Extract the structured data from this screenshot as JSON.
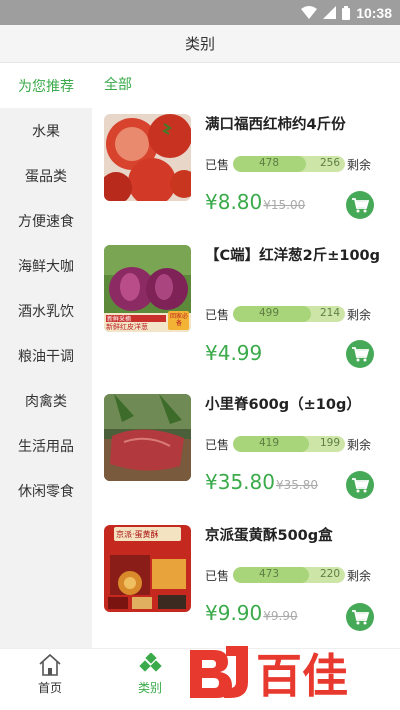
{
  "status_bar": {
    "time": "10:38",
    "icons": [
      "wifi-icon",
      "signal-icon",
      "battery-icon"
    ]
  },
  "header": {
    "title": "类别"
  },
  "sidebar": {
    "items": [
      {
        "label": "为您推荐",
        "active": true
      },
      {
        "label": "水果"
      },
      {
        "label": "蛋品类"
      },
      {
        "label": "方便速食"
      },
      {
        "label": "海鲜大咖"
      },
      {
        "label": "酒水乳饮"
      },
      {
        "label": "粮油干调"
      },
      {
        "label": "肉禽类"
      },
      {
        "label": "生活用品"
      },
      {
        "label": "休闲零食"
      }
    ]
  },
  "main": {
    "filter_label": "全部",
    "products": [
      {
        "name": "满口福西红柿约4斤份",
        "sold_label": "已售",
        "sold": "478",
        "remaining": "256",
        "remaining_label": "剩余",
        "price": "¥8.80",
        "original_price": "¥15.00",
        "sold_fraction": 0.65
      },
      {
        "name": "【C端】红洋葱2斤±100g",
        "sold_label": "已售",
        "sold": "499",
        "remaining": "214",
        "remaining_label": "剩余",
        "price": "¥4.99",
        "original_price": "",
        "sold_fraction": 0.7,
        "image_badges": [
          "新鲜红皮洋葱",
          "新鲜采摘",
          "回家必备"
        ]
      },
      {
        "name": "小里脊600g（±10g）",
        "sold_label": "已售",
        "sold": "419",
        "remaining": "199",
        "remaining_label": "剩余",
        "price": "¥35.80",
        "original_price": "¥35.80",
        "sold_fraction": 0.68
      },
      {
        "name": "京派蛋黄酥500g盒",
        "sold_label": "已售",
        "sold": "473",
        "remaining": "220",
        "remaining_label": "剩余",
        "price": "¥9.90",
        "original_price": "¥9.90",
        "sold_fraction": 0.68,
        "image_badges": [
          "京派·蛋黄酥"
        ]
      }
    ]
  },
  "tab_bar": {
    "tabs": [
      {
        "label": "首页",
        "icon": "home-icon"
      },
      {
        "label": "类别",
        "icon": "category-icon",
        "active": true
      }
    ]
  },
  "watermark": {
    "text": "百佳",
    "logo": "BJ"
  },
  "colors": {
    "accent": "#3aaa4a",
    "cart": "#46a957",
    "bar_bg": "#cde6a8",
    "bar_fill": "#a8d47a"
  }
}
